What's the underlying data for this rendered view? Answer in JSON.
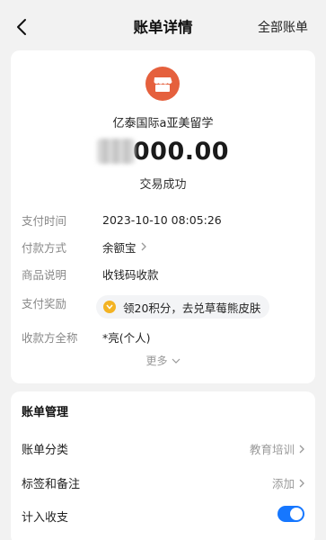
{
  "nav": {
    "title": "账单详情",
    "right_link": "全部账单"
  },
  "bill": {
    "merchant_name": "亿泰国际a亚美留学",
    "merchant_logo_icon": "storefront-icon",
    "merchant_logo_color": "#e5603d",
    "amount": "000.00",
    "status": "交易成功"
  },
  "details": {
    "pay_time_label": "支付时间",
    "pay_time_value": "2023-10-10 08:05:26",
    "pay_method_label": "付款方式",
    "pay_method_value": "余额宝",
    "product_label": "商品说明",
    "product_value": "收钱码收款",
    "reward_label": "支付奖励",
    "reward_text": "领20积分，去兑草莓熊皮肤",
    "payee_label": "收款方全称",
    "payee_value": "*亮(个人)",
    "more_label": "更多"
  },
  "management": {
    "title": "账单管理",
    "category_label": "账单分类",
    "category_value": "教育培训",
    "tags_label": "标签和备注",
    "tags_value": "添加",
    "income_label": "计入收支",
    "income_enabled": true
  },
  "colors": {
    "accent": "#1677ff",
    "coin": "#f3b324"
  }
}
